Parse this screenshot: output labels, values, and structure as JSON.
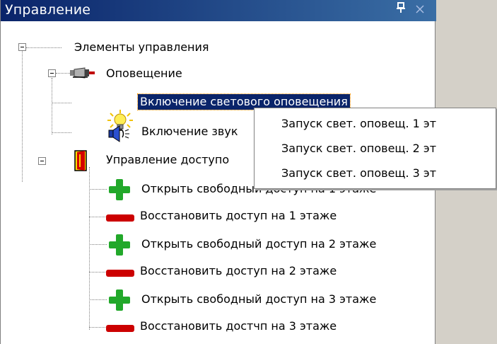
{
  "panel": {
    "title": "Управление",
    "pin_glyph": "ᵠ",
    "close_glyph": "×",
    "pin_icon": "pin-icon",
    "close_icon": "close-icon"
  },
  "tree": {
    "root": {
      "label": "Элементы управления",
      "expanded": true
    },
    "groups": [
      {
        "label": "Оповещение",
        "icon": "siren-icon",
        "expanded": true,
        "items": [
          {
            "label": "Включение светового оповещения",
            "icon": "light-bulb-icon",
            "selected": true
          },
          {
            "label": "Включение звук",
            "icon": "speaker-icon",
            "selected": false
          }
        ]
      },
      {
        "label": "Управление доступо",
        "icon": "door-icon",
        "expanded": true,
        "items": [
          {
            "label": "Открыть свободный доступ на 1 этаже",
            "icon": "plus-icon"
          },
          {
            "label": "Восстановить доступ на 1 этаже",
            "icon": "minus-icon"
          },
          {
            "label": "Открыть свободный доступ на 2 этаже",
            "icon": "plus-icon"
          },
          {
            "label": "Восстановить доступ на 2 этаже",
            "icon": "minus-icon"
          },
          {
            "label": "Открыть свободный доступ на 3 этаже",
            "icon": "plus-icon"
          },
          {
            "label": "Восстановить достчп на 3 этаже",
            "icon": "minus-icon"
          }
        ]
      }
    ]
  },
  "context_menu": {
    "items": [
      "Запуск свет. оповещ. 1 эт",
      "Запуск свет. оповещ. 2 эт",
      "Запуск свет. оповещ. 3 эт"
    ]
  },
  "colors": {
    "titlebar": "#0a246a",
    "selection": "#0a246a",
    "selection_focus": "#ff9900",
    "plus_green": "#1a9a1a",
    "minus_red": "#c00000"
  }
}
